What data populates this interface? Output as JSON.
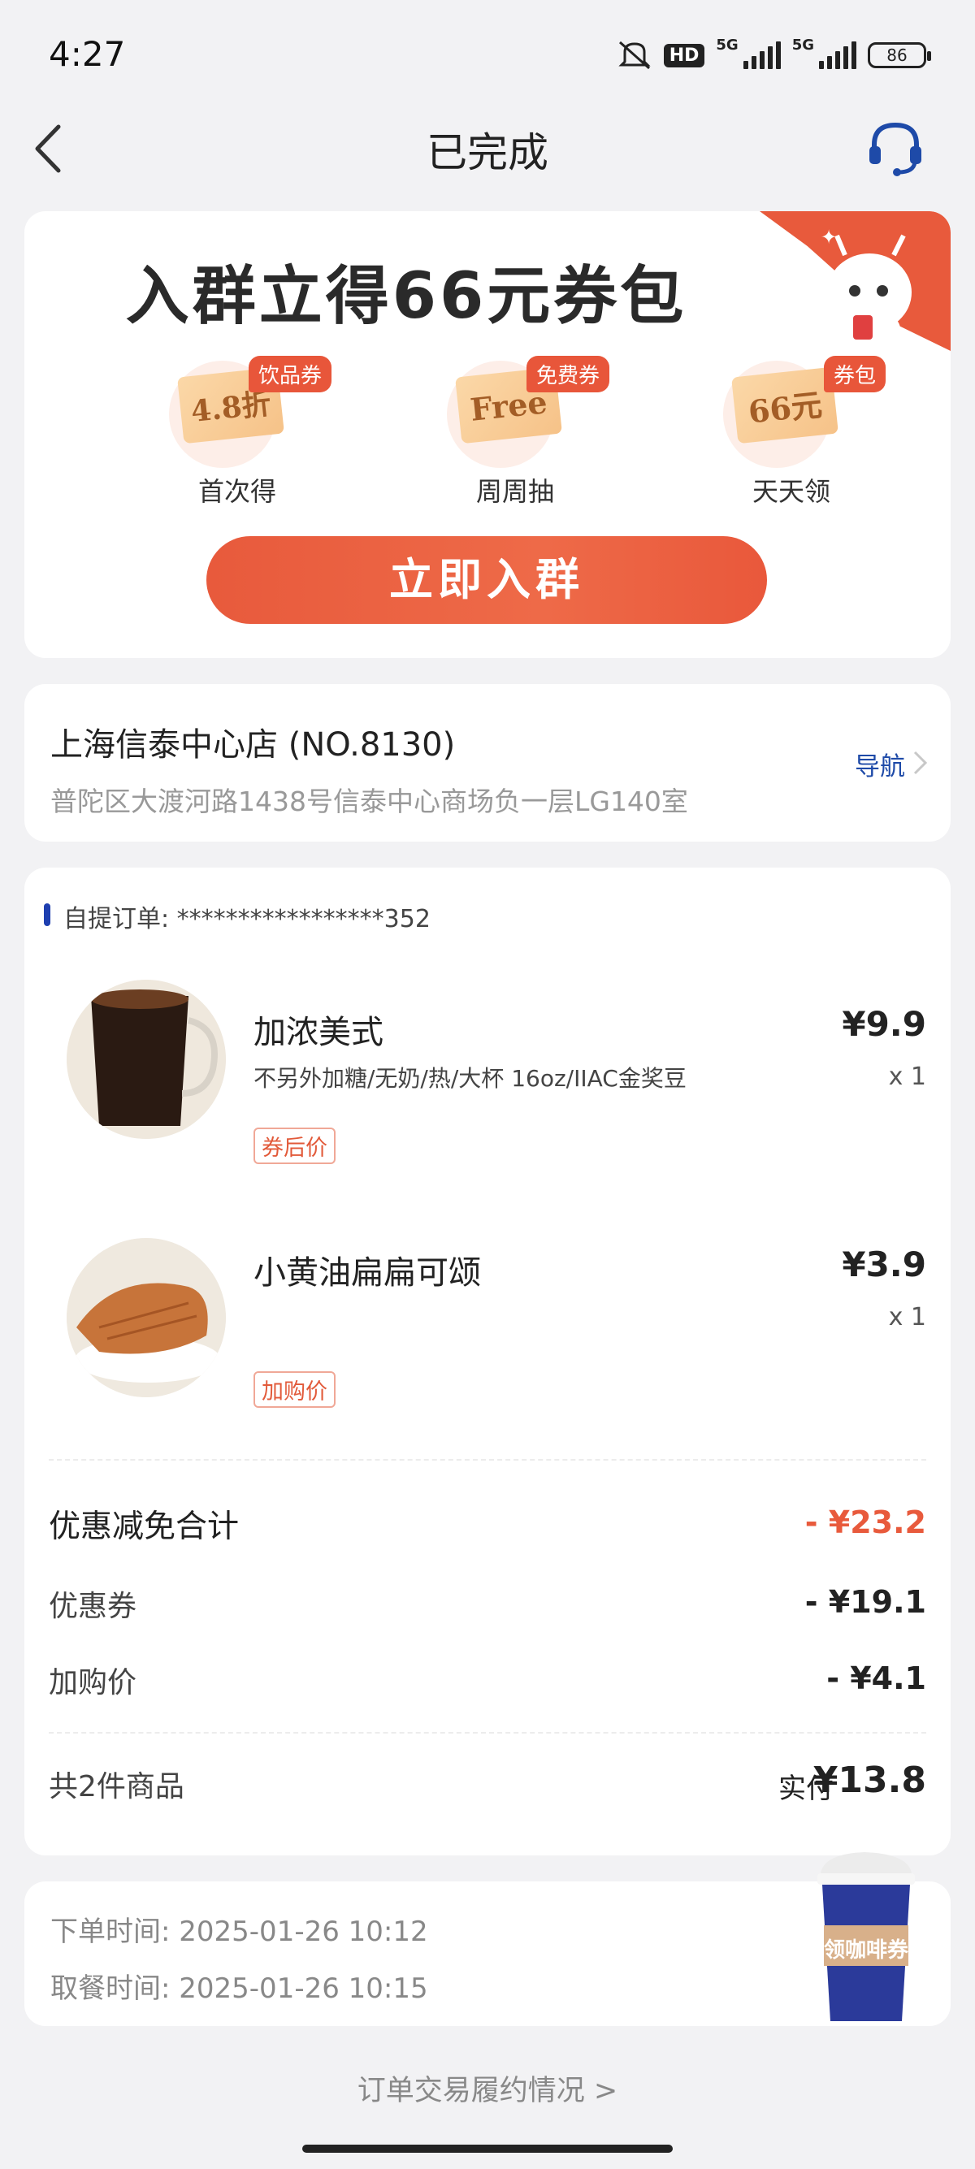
{
  "status_bar": {
    "time": "4:27",
    "net1": "5G",
    "net2": "5G",
    "hd": "HD",
    "battery": "86"
  },
  "header": {
    "title": "已完成",
    "back_icon": "back-chevron-icon",
    "support_icon": "headset-icon"
  },
  "promo": {
    "title": "入群立得66元券包",
    "coupons": [
      {
        "badge": "饮品券",
        "ticket": "4.8折",
        "label": "首次得"
      },
      {
        "badge": "免费券",
        "ticket": "Free",
        "label": "周周抽"
      },
      {
        "badge": "券包",
        "ticket": "66元",
        "label": "天天领"
      }
    ],
    "button": "立即入群"
  },
  "store": {
    "name": "上海信泰中心店 (NO.8130)",
    "address": "普陀区大渡河路1438号信泰中心商场负一层LG140室",
    "nav_label": "导航"
  },
  "order": {
    "order_no": "自提订单: *****************352",
    "items": [
      {
        "name": "加浓美式",
        "spec": "不另外加糖/无奶/热/大杯 16oz/IIAC金奖豆",
        "tag": "券后价",
        "price": "¥9.9",
        "qty": "x 1"
      },
      {
        "name": "小黄油扁扁可颂",
        "spec": "",
        "tag": "加购价",
        "price": "¥3.9",
        "qty": "x 1"
      }
    ],
    "discount_total_label": "优惠减免合计",
    "discount_total_value": "- ¥23.2",
    "coupon_label": "优惠券",
    "coupon_value": "- ¥19.1",
    "addon_label": "加购价",
    "addon_value": "- ¥4.1",
    "count_label": "共2件商品",
    "paid_label": "实付",
    "paid_value": "¥13.8"
  },
  "times": {
    "order_time": "下单时间:  2025-01-26 10:12",
    "pickup_time": "取餐时间:  2025-01-26 10:15",
    "cup_label": "领咖啡券"
  },
  "footer": {
    "link": "订单交易履约情况 >"
  },
  "colors": {
    "accent": "#e85a3c",
    "nav_blue": "#1e4aa8",
    "background": "#f2f2f4"
  }
}
